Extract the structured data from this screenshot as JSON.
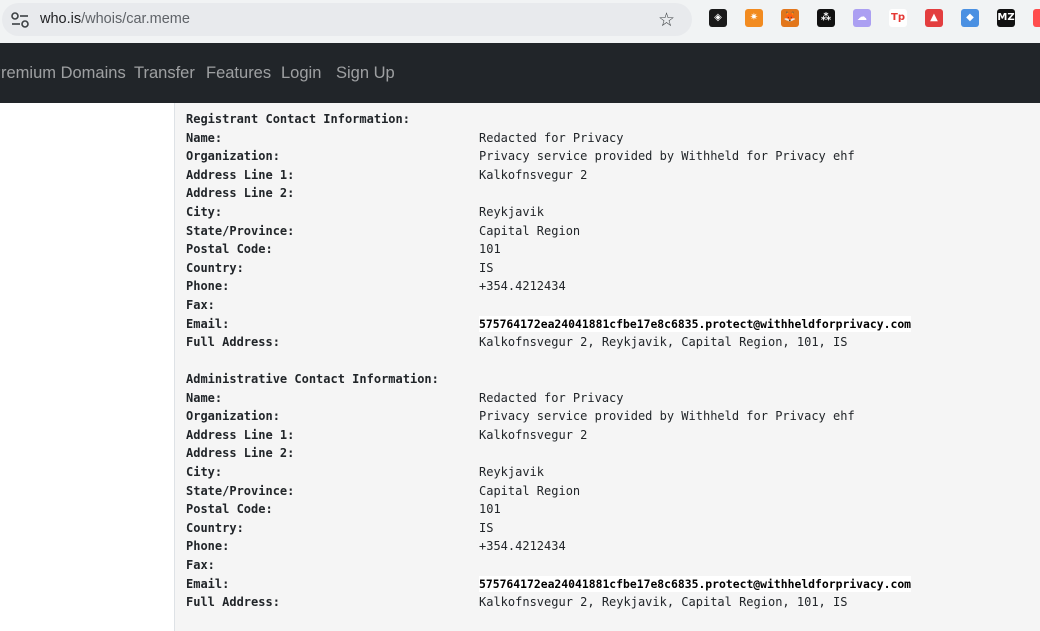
{
  "browser": {
    "url_host": "who.is",
    "url_path": "/whois/car.meme",
    "extensions": [
      {
        "icon": "compass-extension-icon",
        "color": "#1a1a1a",
        "glyph": "◈"
      },
      {
        "icon": "sparkle-extension-icon",
        "color": "#f28b20",
        "glyph": "✷"
      },
      {
        "icon": "metamask-fox-icon",
        "color": "#e2761b",
        "glyph": "🦊"
      },
      {
        "icon": "cube-extension-icon",
        "color": "#111111",
        "glyph": "⁂"
      },
      {
        "icon": "ghost-wallet-icon",
        "color": "#ab9ff2",
        "glyph": "☁"
      },
      {
        "icon": "tp-extension-icon",
        "color": "#ffffff",
        "glyph": "Tp"
      },
      {
        "icon": "backpack-icon",
        "color": "#e33e3f",
        "glyph": "▲"
      },
      {
        "icon": "drop-extension-icon",
        "color": "#4a90e2",
        "glyph": "◆"
      },
      {
        "icon": "mz-extension-icon",
        "color": "#111111",
        "glyph": "MZ"
      },
      {
        "icon": "red-extension-icon",
        "color": "#ff4d4d",
        "glyph": ""
      }
    ]
  },
  "nav": {
    "items": [
      "Premium Domains",
      "Transfer",
      "Features",
      "Login",
      "Sign Up"
    ]
  },
  "registrant": {
    "heading": "Registrant Contact Information:",
    "fields": [
      {
        "label": "Name:",
        "value": "Redacted for Privacy"
      },
      {
        "label": "Organization:",
        "value": "Privacy service provided by Withheld for Privacy ehf"
      },
      {
        "label": "Address Line 1:",
        "value": "Kalkofnsvegur 2"
      },
      {
        "label": "Address Line 2:",
        "value": ""
      },
      {
        "label": "City:",
        "value": "Reykjavik"
      },
      {
        "label": "State/Province:",
        "value": "Capital Region"
      },
      {
        "label": "Postal Code:",
        "value": "101"
      },
      {
        "label": "Country:",
        "value": "IS"
      },
      {
        "label": "Phone:",
        "value": "+354.4212434"
      },
      {
        "label": "Fax:",
        "value": ""
      },
      {
        "label": "Email:",
        "value": "575764172ea24041881cfbe17e8c6835.protect@withheldforprivacy.com"
      },
      {
        "label": "Full Address:",
        "value": "Kalkofnsvegur 2, Reykjavik, Capital Region, 101, IS"
      }
    ]
  },
  "administrative": {
    "heading": "Administrative Contact Information:",
    "fields": [
      {
        "label": "Name:",
        "value": "Redacted for Privacy"
      },
      {
        "label": "Organization:",
        "value": "Privacy service provided by Withheld for Privacy ehf"
      },
      {
        "label": "Address Line 1:",
        "value": "Kalkofnsvegur 2"
      },
      {
        "label": "Address Line 2:",
        "value": ""
      },
      {
        "label": "City:",
        "value": "Reykjavik"
      },
      {
        "label": "State/Province:",
        "value": "Capital Region"
      },
      {
        "label": "Postal Code:",
        "value": "101"
      },
      {
        "label": "Country:",
        "value": "IS"
      },
      {
        "label": "Phone:",
        "value": "+354.4212434"
      },
      {
        "label": "Fax:",
        "value": ""
      },
      {
        "label": "Email:",
        "value": "575764172ea24041881cfbe17e8c6835.protect@withheldforprivacy.com"
      },
      {
        "label": "Full Address:",
        "value": "Kalkofnsvegur 2, Reykjavik, Capital Region, 101, IS"
      }
    ]
  }
}
